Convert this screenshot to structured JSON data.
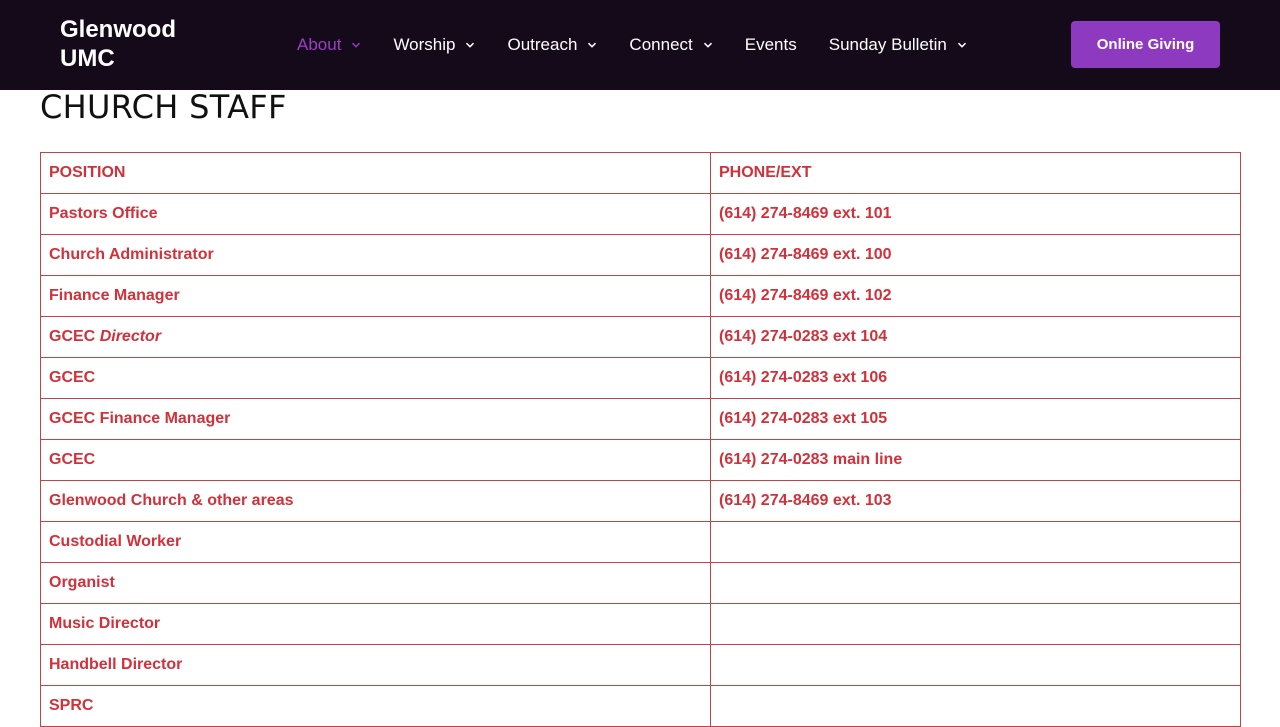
{
  "header": {
    "logo_line1": "Glenwood",
    "logo_line2": "UMC",
    "nav": [
      {
        "label": "About",
        "has_dropdown": true,
        "active": true
      },
      {
        "label": "Worship",
        "has_dropdown": true,
        "active": false
      },
      {
        "label": "Outreach",
        "has_dropdown": true,
        "active": false
      },
      {
        "label": "Connect",
        "has_dropdown": true,
        "active": false
      },
      {
        "label": "Events",
        "has_dropdown": false,
        "active": false
      },
      {
        "label": "Sunday Bulletin",
        "has_dropdown": true,
        "active": false
      }
    ],
    "give_label": "Online Giving"
  },
  "page": {
    "title": "CHURCH STAFF"
  },
  "table": {
    "headers": [
      "POSITION",
      "PHONE/EXT"
    ],
    "rows": [
      {
        "position": "Pastors Office",
        "phone": "(614) 274-8469 ext. 101"
      },
      {
        "position": "Church Administrator",
        "phone": "(614) 274-8469 ext. 100"
      },
      {
        "position": "Finance Manager",
        "phone": "(614) 274-8469 ext. 102"
      },
      {
        "position": "GCEC",
        "position_em": "Director",
        "phone": "(614) 274-0283 ext 104"
      },
      {
        "position": "GCEC",
        "phone": "(614) 274-0283 ext 106"
      },
      {
        "position": "GCEC Finance Manager",
        "phone": "(614) 274-0283 ext 105"
      },
      {
        "position": "GCEC",
        "phone": "(614) 274-0283 main line"
      },
      {
        "position": "Glenwood Church & other areas",
        "phone": "(614) 274-8469 ext. 103"
      },
      {
        "position": "Custodial Worker",
        "phone": ""
      },
      {
        "position": "Organist",
        "phone": ""
      },
      {
        "position": "Music Director",
        "phone": ""
      },
      {
        "position": "Handbell Director",
        "phone": ""
      },
      {
        "position": "SPRC",
        "phone": ""
      }
    ]
  },
  "colors": {
    "header_bg": "#140a19",
    "accent": "#8e3ac0",
    "table_text": "#d0313a",
    "table_border": "#c0454b"
  },
  "icons": {
    "dropdown": "chevron-down-icon"
  }
}
